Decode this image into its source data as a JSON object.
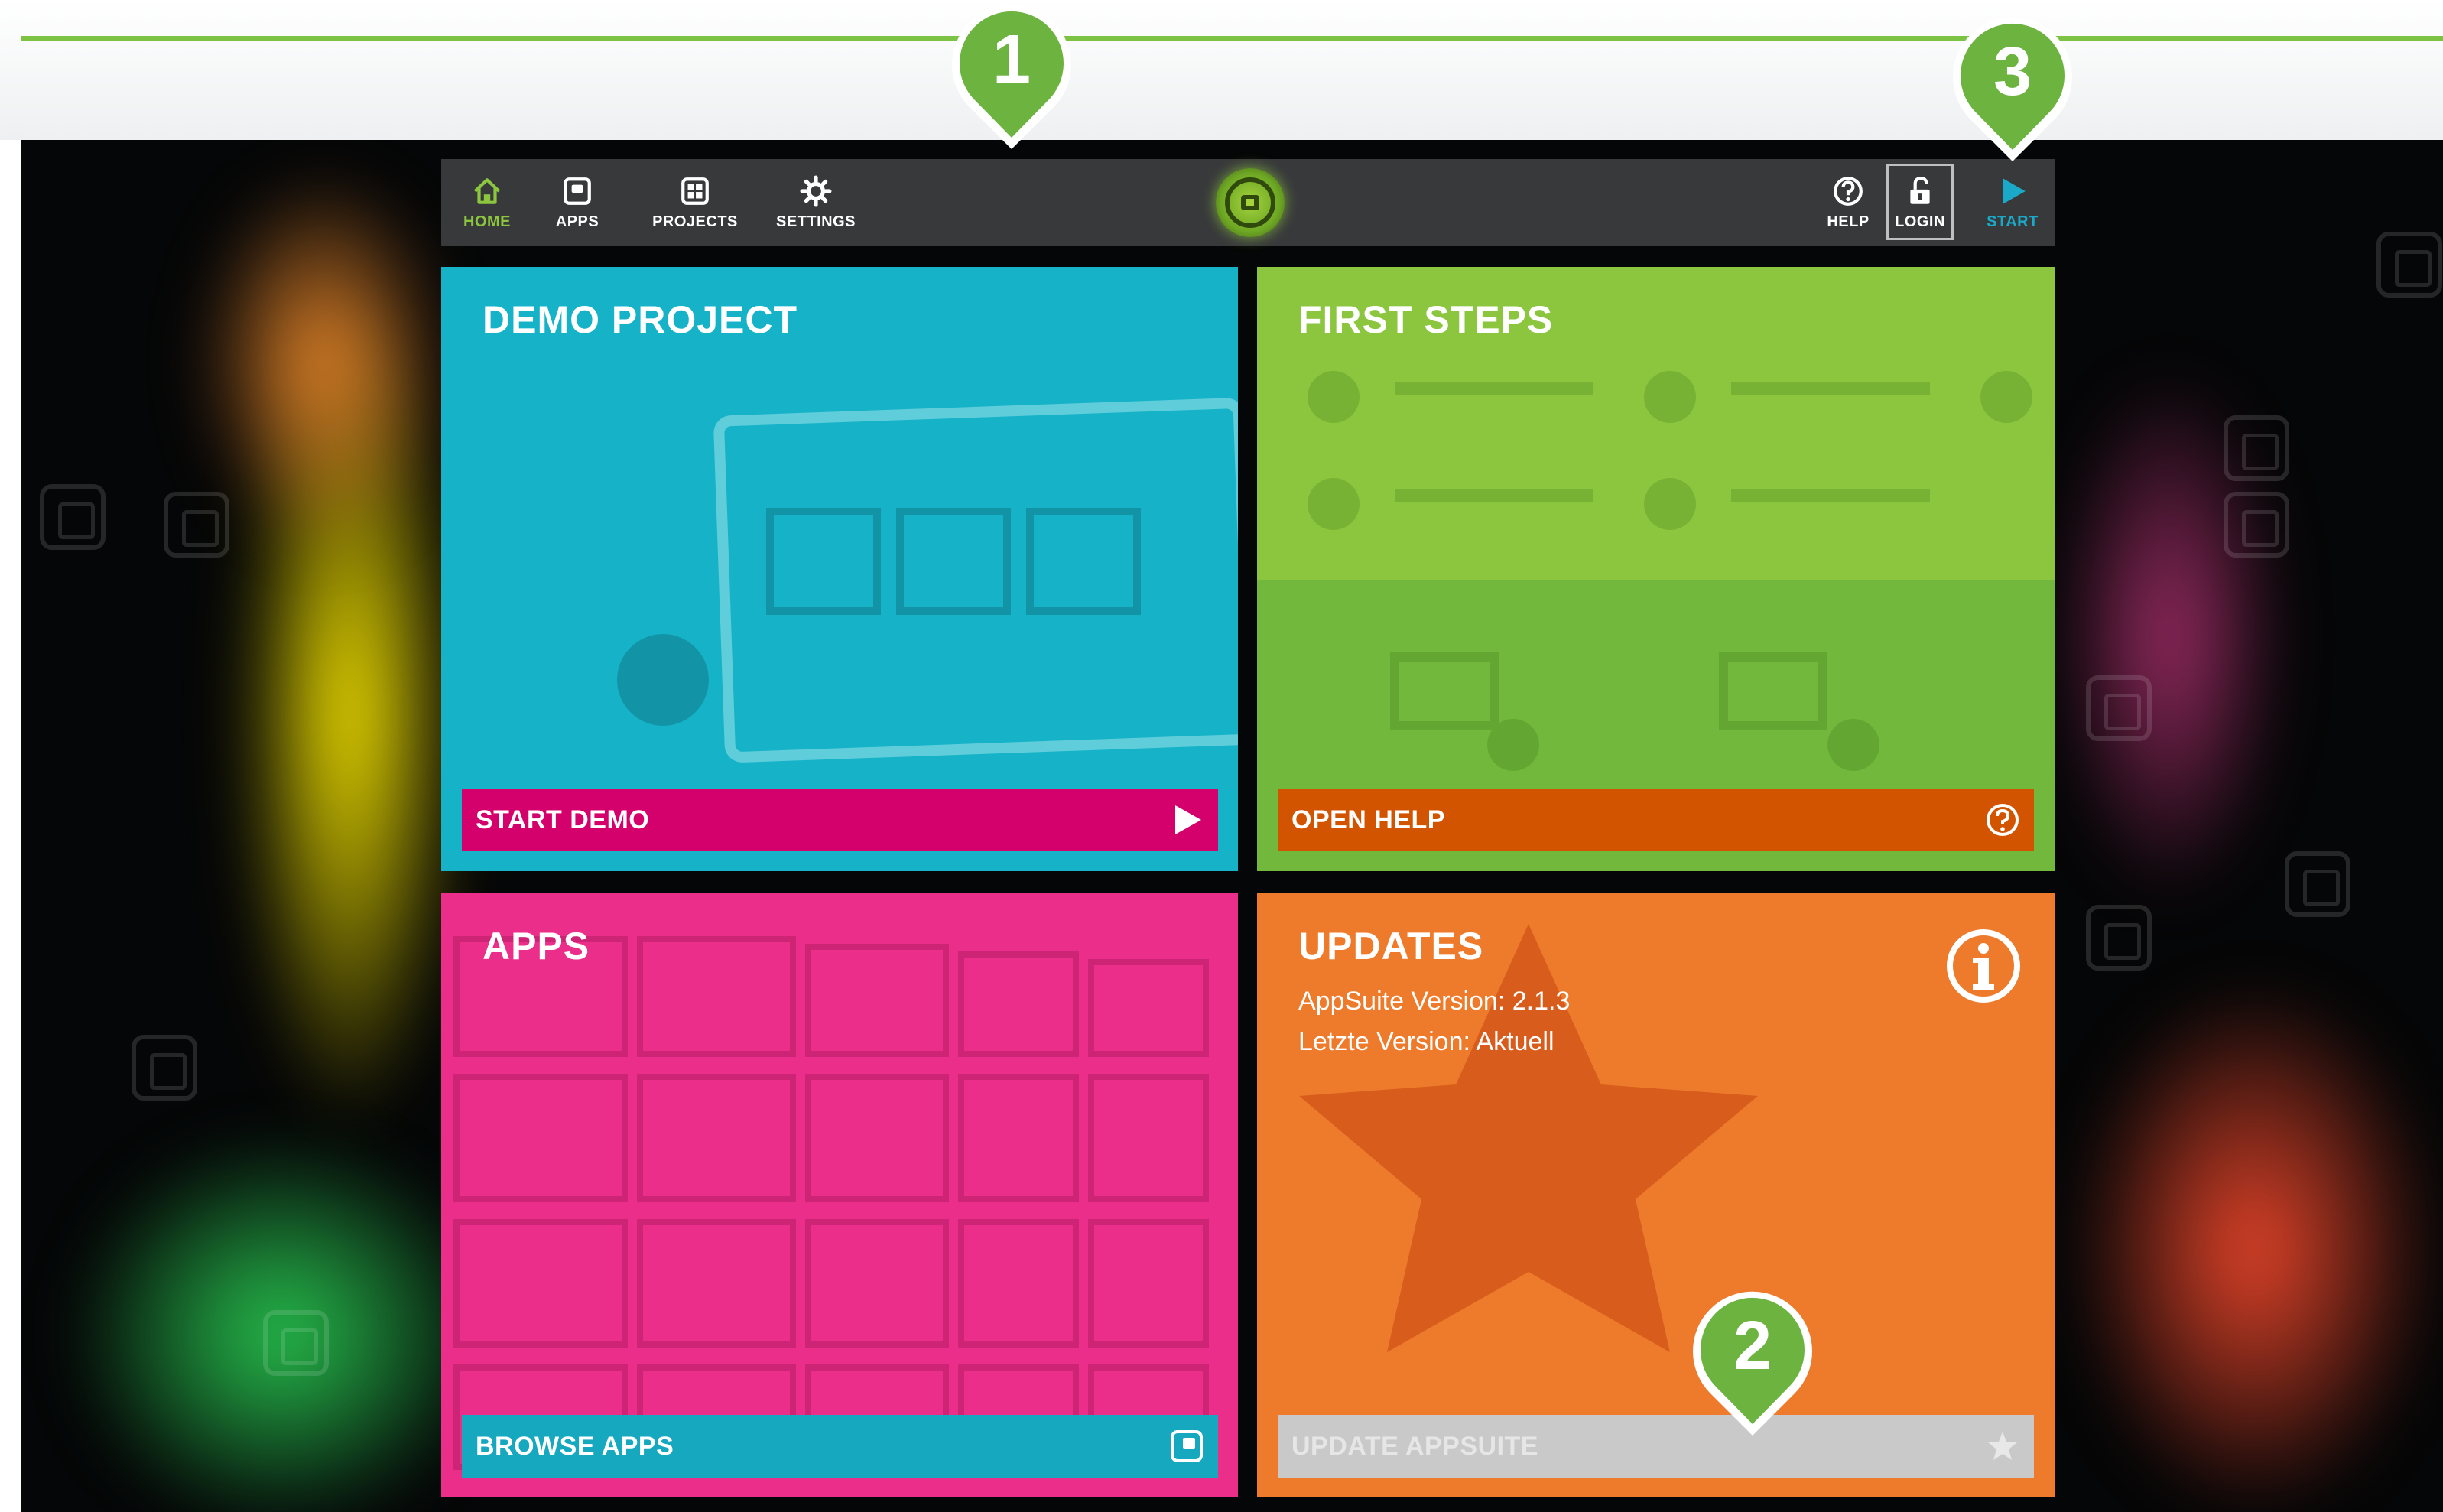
{
  "nav": {
    "home_label": "HOME",
    "apps_label": "APPS",
    "projects_label": "PROJECTS",
    "settings_label": "SETTINGS",
    "help_label": "HELP",
    "login_label": "LOGIN",
    "start_label": "START"
  },
  "tiles": {
    "demo": {
      "title": "DEMO PROJECT",
      "action": "START DEMO",
      "icon": "play-icon",
      "color": "#16b3c8",
      "bar_color": "#d4006b"
    },
    "first_steps": {
      "title": "FIRST STEPS",
      "action": "OPEN HELP",
      "icon": "question-circle-icon",
      "color": "#8cc63f",
      "bar_color": "#d35400"
    },
    "apps": {
      "title": "APPS",
      "action": "BROWSE APPS",
      "icon": "app-square-icon",
      "color": "#ea2e8a",
      "bar_color": "#16a8bf"
    },
    "updates": {
      "title": "UPDATES",
      "version_line": "AppSuite Version: 2.1.3",
      "latest_line": "Letzte Version: Aktuell",
      "action": "UPDATE APPSUITE",
      "icon": "star-icon",
      "info_icon": "info-icon",
      "color": "#ee7b2b",
      "bar_color": "#c9c9c9"
    }
  },
  "markers": [
    "1",
    "2",
    "3"
  ],
  "colors": {
    "accent_green": "#8cc63f",
    "marker_green": "#7cc243",
    "navbar": "#38393b"
  }
}
